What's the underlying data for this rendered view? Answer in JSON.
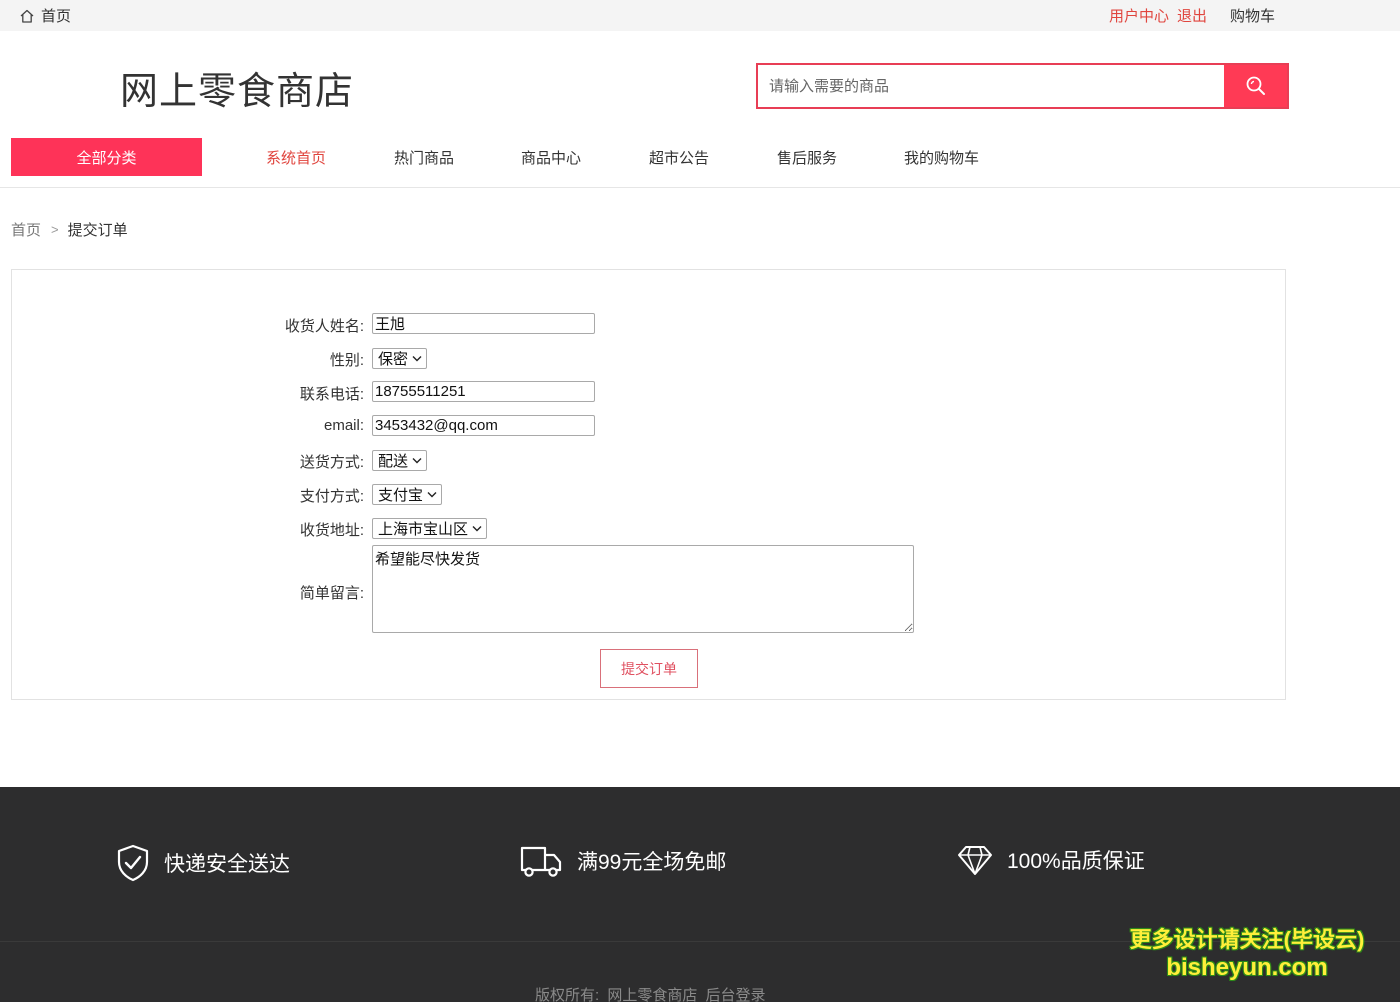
{
  "topbar": {
    "home_label": "首页",
    "user_center": "用户中心",
    "logout": "退出",
    "cart": "购物车"
  },
  "header": {
    "logo": "网上零食商店",
    "search_placeholder": "请输入需要的商品"
  },
  "nav": {
    "all_categories": "全部分类",
    "items": [
      "系统首页",
      "热门商品",
      "商品中心",
      "超市公告",
      "售后服务",
      "我的购物车"
    ],
    "active_index": 0
  },
  "breadcrumb": {
    "home": "首页",
    "current": "提交订单"
  },
  "form": {
    "name_label": "收货人姓名:",
    "name_value": "王旭",
    "gender_label": "性别:",
    "gender_value": "保密",
    "phone_label": "联系电话:",
    "phone_value": "18755511251",
    "email_label": "email:",
    "email_value": "3453432@qq.com",
    "delivery_label": "送货方式:",
    "delivery_value": "配送",
    "payment_label": "支付方式:",
    "payment_value": "支付宝",
    "address_label": "收货地址:",
    "address_value": "上海市宝山区",
    "message_label": "简单留言:",
    "message_value": "希望能尽快发货",
    "submit_label": "提交订单"
  },
  "footer": {
    "features": [
      "快递安全送达",
      "满99元全场免邮",
      "100%品质保证"
    ],
    "copyright_prefix": "版权所有:",
    "store_name": "网上零食商店",
    "admin_login": "后台登录"
  },
  "watermark": {
    "line1": "更多设计请关注(毕设云)",
    "line2": "bisheyun.com"
  },
  "colors": {
    "accent": "#fe3358",
    "link_red": "#e0453e",
    "footer_bg": "#2d2d2e"
  }
}
